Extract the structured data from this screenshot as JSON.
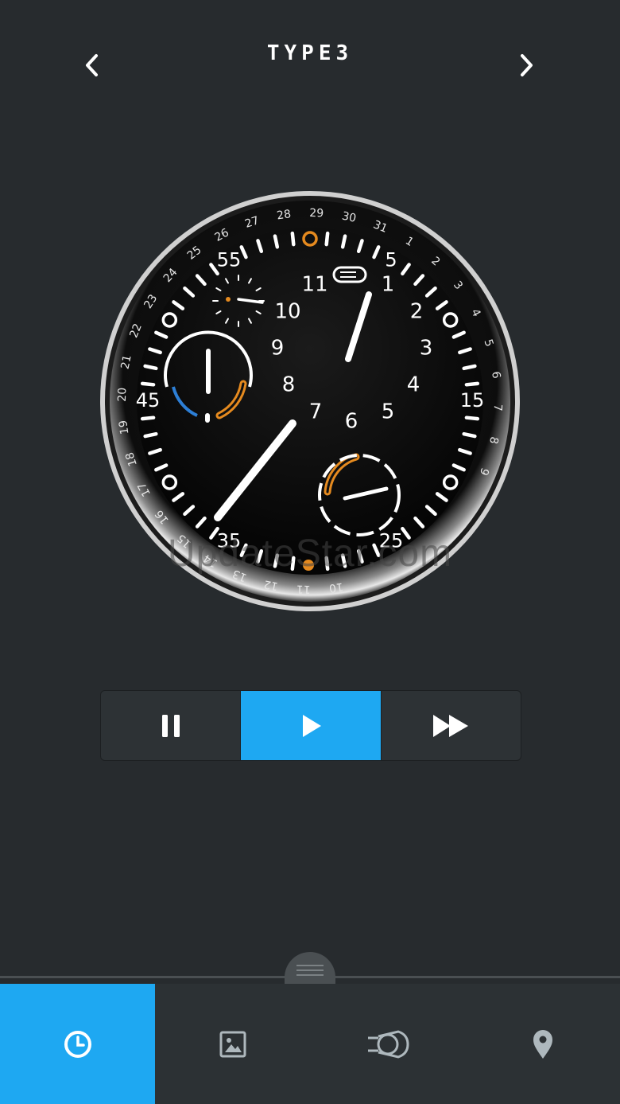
{
  "header": {
    "title": "TYPE3",
    "prev_icon": "chevron-left-icon",
    "next_icon": "chevron-right-icon"
  },
  "watch": {
    "hour_numerals": [
      "1",
      "2",
      "3",
      "4",
      "5",
      "6",
      "7",
      "8",
      "9",
      "10",
      "11"
    ],
    "minute_numerals": [
      "5",
      "15",
      "25",
      "35",
      "45",
      "55"
    ],
    "date_numerals": [
      "9",
      "8",
      "7",
      "6",
      "5",
      "4",
      "3",
      "2",
      "1",
      "31",
      "30",
      "29",
      "28",
      "27",
      "26",
      "25",
      "24",
      "23",
      "22",
      "21",
      "20",
      "19",
      "18",
      "17",
      "16",
      "15",
      "14",
      "13",
      "12",
      "11",
      "10"
    ],
    "accent_orange": "#e58a1f",
    "accent_blue": "#2d7fd6"
  },
  "watermark": "UpdateStar.com",
  "controls": [
    {
      "icon": "pause-icon",
      "active": false
    },
    {
      "icon": "play-icon",
      "active": true
    },
    {
      "icon": "fast-forward-icon",
      "active": false
    }
  ],
  "tabs": [
    {
      "icon": "clock-icon",
      "active": true
    },
    {
      "icon": "image-icon",
      "active": false
    },
    {
      "icon": "watch-icon",
      "active": false
    },
    {
      "icon": "location-pin-icon",
      "active": false
    }
  ],
  "colors": {
    "background": "#272b2e",
    "accent": "#1ea8f2",
    "tabbar": "#2c3134"
  }
}
